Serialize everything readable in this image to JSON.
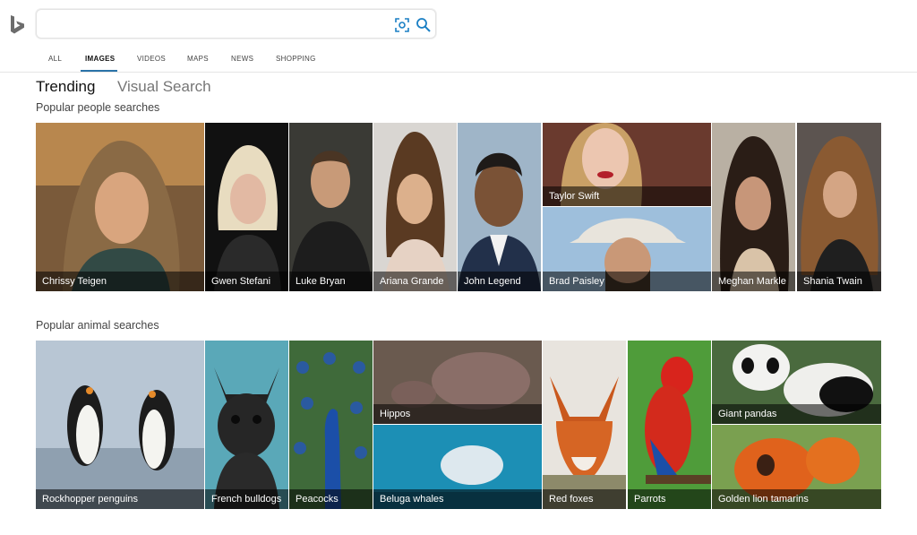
{
  "app": {
    "logo_icon": "bing-logo-icon"
  },
  "search": {
    "value": "",
    "placeholder": "",
    "visual_icon": "visual-search-icon",
    "search_icon": "search-icon"
  },
  "nav": {
    "tabs": [
      "ALL",
      "IMAGES",
      "VIDEOS",
      "MAPS",
      "NEWS",
      "SHOPPING"
    ],
    "active": "IMAGES"
  },
  "subtabs": {
    "trending": "Trending",
    "visual_search": "Visual Search"
  },
  "sections": {
    "people": {
      "title": "Popular people searches",
      "items": [
        "Chrissy Teigen",
        "Gwen Stefani",
        "Luke Bryan",
        "Ariana Grande",
        "John Legend",
        "Taylor Swift",
        "Brad Paisley",
        "Meghan Markle",
        "Shania Twain"
      ]
    },
    "animals": {
      "title": "Popular animal searches",
      "items": [
        "Rockhopper penguins",
        "French bulldogs",
        "Peacocks",
        "Hippos",
        "Beluga whales",
        "Red foxes",
        "Parrots",
        "Giant pandas",
        "Golden lion tamarins"
      ]
    }
  },
  "colors": {
    "accent": "#2a73a8",
    "caption_bg": "rgba(0,0,0,0.55)"
  }
}
